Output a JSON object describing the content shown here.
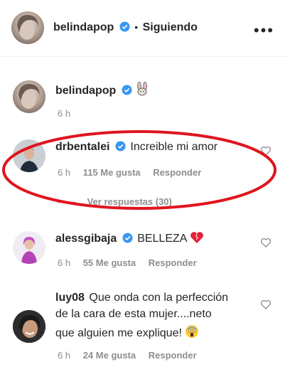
{
  "header": {
    "username": "belindapop",
    "separator": "•",
    "follow_status": "Siguiendo",
    "more_icon": "more-options-icon"
  },
  "caption": {
    "username": "belindapop",
    "time": "6 h"
  },
  "comments": [
    {
      "username": "drbentalei",
      "text": "Increible mi amor",
      "time": "6 h",
      "likes": "115 Me gusta",
      "reply": "Responder",
      "view_replies": "Ver respuestas (30)"
    },
    {
      "username": "alessgibaja",
      "text": "BELLEZA",
      "time": "6 h",
      "likes": "55 Me gusta",
      "reply": "Responder"
    },
    {
      "username": "luy08",
      "text_line1": "Que onda con la perfección",
      "text_line2": "de la cara de esta mujer....neto",
      "text_line3": "que alguien me explique!",
      "time": "6 h",
      "likes": "24 Me gusta",
      "reply": "Responder"
    }
  ],
  "colors": {
    "verified": "#3897f0",
    "annotation_ellipse": "#e0141e",
    "meta_text": "#8e8e8e"
  }
}
